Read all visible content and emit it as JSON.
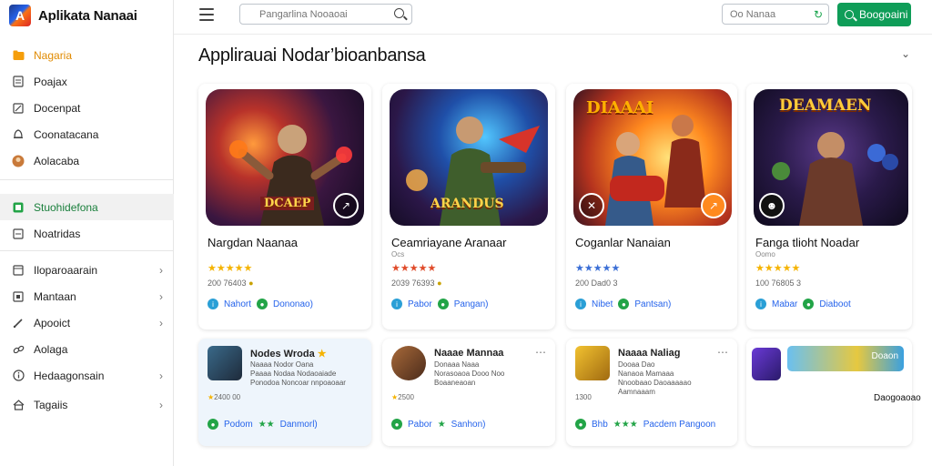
{
  "app": {
    "title": "Aplikata Nanaai",
    "logo_letter": "A"
  },
  "sidebar": {
    "items": [
      {
        "label": "Nagaria",
        "icon": "folder-icon",
        "active": false
      },
      {
        "label": "Poajax",
        "icon": "document-icon"
      },
      {
        "label": "Docenpat",
        "icon": "edit-icon"
      },
      {
        "label": "Coonatacana",
        "icon": "bell-icon"
      },
      {
        "label": "Aolacaba",
        "icon": "avatar-icon"
      },
      {
        "label": "Stuohidefona",
        "icon": "store-icon"
      },
      {
        "label": "Noatridas",
        "icon": "document-icon"
      },
      {
        "label": "Iloparoaarain",
        "icon": "box-icon"
      },
      {
        "label": "Mantaan",
        "icon": "box-icon"
      },
      {
        "label": "Apooict",
        "icon": "pen-icon"
      },
      {
        "label": "Aolaga",
        "icon": "link-icon"
      },
      {
        "label": "Hedaagonsain",
        "icon": "info-icon"
      },
      {
        "label": "Tagaiis",
        "icon": "home-icon"
      }
    ]
  },
  "topbar": {
    "search_placeholder": "Pangarlina Nooaoai",
    "filter_label": "Oo Nanaa",
    "primary_button": "Boogoaini"
  },
  "main": {
    "title": "Applirauai Nodar’bioanbansa",
    "cards": [
      {
        "title": "Nargdan Naanaa",
        "sub": "",
        "meta": "200 76403",
        "foot_a": "Nahort",
        "foot_b": "Dononao)",
        "art": "DCAEP"
      },
      {
        "title": "Ceamriayane Aranaar",
        "sub": "Ocs",
        "meta": "2039 76393",
        "foot_a": "Pabor",
        "foot_b": "Pangan)",
        "art": "ARANDUS"
      },
      {
        "title": "Coganlar Nanaian",
        "sub": "",
        "meta": "200 Dad0 3",
        "foot_a": "Nibet",
        "foot_b": "Pantsan)",
        "art": "DIAAAI"
      },
      {
        "title": "Fanga tlioht Noadar",
        "sub": "Oomo",
        "meta": "100 76805 3",
        "foot_a": "Mabar",
        "foot_b": "Diaboot",
        "art": "DEAMAEN"
      }
    ],
    "mini_cards": [
      {
        "title": "Nodes Wroda",
        "lines": "Naaaa Nodor Oana\nPaaaa Nodaa Nodaoaiade\nPonodoa Noncoar nnpoaoaar",
        "meta": "2400  00",
        "foot_a": "Podom",
        "foot_b": "Danmorl)"
      },
      {
        "title": "Naaae Mannaa",
        "lines": "Donaaa  Naaa\nNorasoaoa Dooo Noo\nBoaaneaoan",
        "meta": "2500",
        "foot_a": "Pabor",
        "foot_b": "Sanhon)"
      },
      {
        "title": "Naaaa Naliag",
        "lines": "Dooaa  Dao\nNanaoa  Mamaaa\nNnoobaao Daoaaaaao\nAamnaaam",
        "meta": "1300",
        "foot_a": "Bhb",
        "foot_b": "Pacdem Pangoon"
      },
      {
        "title": "",
        "lines": "",
        "meta": "Daogoaoao",
        "foot_a": "Doaon",
        "foot_b": ""
      }
    ]
  },
  "colors": {
    "accent": "#0f9d58",
    "link": "#2563eb",
    "star": "#f5b301"
  }
}
